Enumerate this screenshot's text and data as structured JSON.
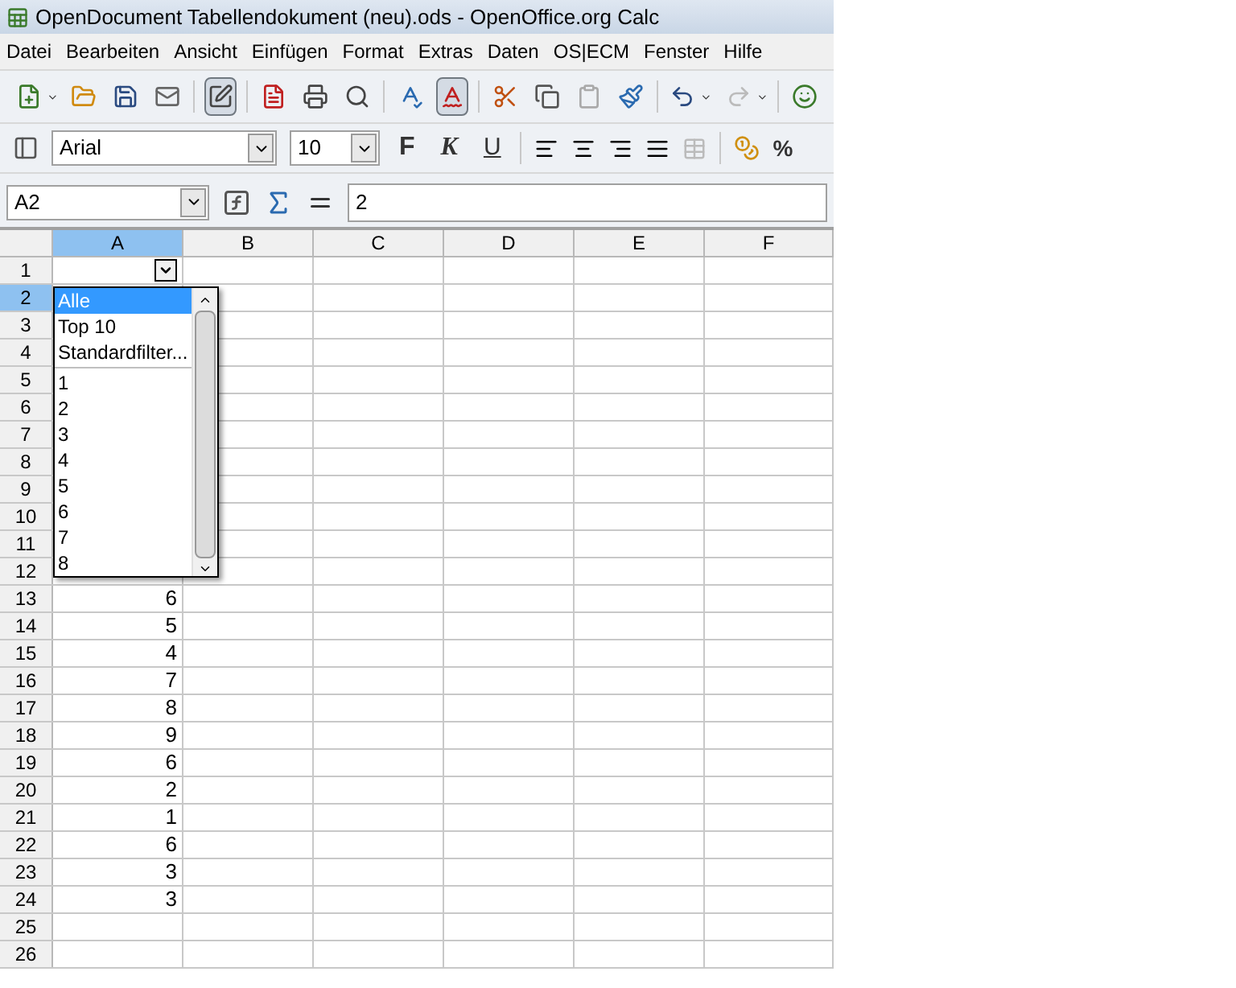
{
  "window": {
    "title": "OpenDocument Tabellendokument (neu).ods - OpenOffice.org Calc"
  },
  "menu": [
    "Datei",
    "Bearbeiten",
    "Ansicht",
    "Einfügen",
    "Format",
    "Extras",
    "Daten",
    "OS|ECM",
    "Fenster",
    "Hilfe"
  ],
  "standard_toolbar": [
    {
      "kind": "new",
      "pressed": false
    },
    {
      "kind": "open",
      "pressed": false
    },
    {
      "kind": "save",
      "pressed": false
    },
    {
      "kind": "mail",
      "pressed": false
    },
    {
      "kind": "edit",
      "pressed": true
    },
    {
      "kind": "pdf",
      "pressed": false
    },
    {
      "kind": "print",
      "pressed": false
    },
    {
      "kind": "preview",
      "pressed": false
    },
    {
      "kind": "spell",
      "pressed": false
    },
    {
      "kind": "autospell",
      "pressed": true
    },
    {
      "kind": "cut",
      "pressed": false
    },
    {
      "kind": "copy",
      "pressed": false
    },
    {
      "kind": "paste",
      "pressed": false
    },
    {
      "kind": "brush",
      "pressed": false
    },
    {
      "kind": "undo",
      "pressed": false
    },
    {
      "kind": "redo",
      "pressed": false
    },
    {
      "kind": "smile",
      "pressed": false
    }
  ],
  "format_toolbar": {
    "font": "Arial",
    "size": "10",
    "bold": "F",
    "italic": "K",
    "underline": "U",
    "percent": "%"
  },
  "formula_bar": {
    "name_box": "A2",
    "value": "2"
  },
  "columns": [
    {
      "label": "A",
      "selected": true
    },
    {
      "label": "B",
      "selected": false
    },
    {
      "label": "C",
      "selected": false
    },
    {
      "label": "D",
      "selected": false
    },
    {
      "label": "E",
      "selected": false
    },
    {
      "label": "F",
      "selected": false
    }
  ],
  "rows": [
    {
      "label": "1",
      "selected": false,
      "filter": true
    },
    {
      "label": "2",
      "selected": true
    },
    {
      "label": "3",
      "selected": false
    },
    {
      "label": "4",
      "selected": false
    },
    {
      "label": "5",
      "selected": false
    },
    {
      "label": "6",
      "selected": false
    },
    {
      "label": "7",
      "selected": false
    },
    {
      "label": "8",
      "selected": false
    },
    {
      "label": "9",
      "selected": false
    },
    {
      "label": "10",
      "selected": false
    },
    {
      "label": "11",
      "selected": false
    },
    {
      "label": "12",
      "selected": false
    },
    {
      "label": "13",
      "selected": false,
      "a": "6"
    },
    {
      "label": "14",
      "selected": false,
      "a": "5"
    },
    {
      "label": "15",
      "selected": false,
      "a": "4"
    },
    {
      "label": "16",
      "selected": false,
      "a": "7"
    },
    {
      "label": "17",
      "selected": false,
      "a": "8"
    },
    {
      "label": "18",
      "selected": false,
      "a": "9"
    },
    {
      "label": "19",
      "selected": false,
      "a": "6"
    },
    {
      "label": "20",
      "selected": false,
      "a": "2"
    },
    {
      "label": "21",
      "selected": false,
      "a": "1"
    },
    {
      "label": "22",
      "selected": false,
      "a": "6"
    },
    {
      "label": "23",
      "selected": false,
      "a": "3"
    },
    {
      "label": "24",
      "selected": false,
      "a": "3"
    },
    {
      "label": "25",
      "selected": false
    },
    {
      "label": "26",
      "selected": false
    }
  ],
  "filter_dropdown": {
    "special_items": [
      {
        "label": "Alle",
        "selected": true
      },
      {
        "label": "Top 10",
        "selected": false
      },
      {
        "label": "Standardfilter...",
        "selected": false
      }
    ],
    "value_items": [
      {
        "label": "1",
        "selected": false
      },
      {
        "label": "2",
        "selected": false
      },
      {
        "label": "3",
        "selected": false
      },
      {
        "label": "4",
        "selected": false
      },
      {
        "label": "5",
        "selected": false
      },
      {
        "label": "6",
        "selected": false
      },
      {
        "label": "7",
        "selected": false
      },
      {
        "label": "8",
        "selected": false
      }
    ]
  }
}
